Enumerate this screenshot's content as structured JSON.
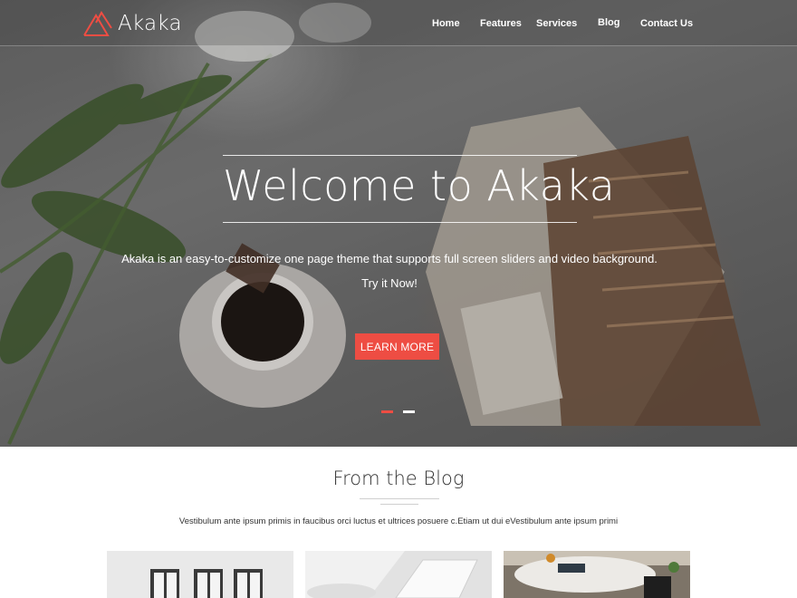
{
  "brand": {
    "name": "Akaka",
    "accent": "#ee4d43"
  },
  "nav": [
    {
      "label": "Home"
    },
    {
      "label": "Features"
    },
    {
      "label": "Services"
    },
    {
      "label": "Blog"
    },
    {
      "label": "Contact Us"
    }
  ],
  "hero": {
    "title": "Welcome to Akaka",
    "subtitle": "Akaka is an easy-to-customize one page theme that supports full screen sliders and video background.",
    "tagline": "Try it Now!",
    "cta_label": "LEARN MORE",
    "slider": {
      "slide_count": 2,
      "active_slide": 1,
      "active_color": "#ee4d43",
      "inactive_color": "#ffffff"
    }
  },
  "blog": {
    "title": "From the Blog",
    "description": "Vestibulum ante ipsum primis in faucibus orci luctus et ultrices posuere c.Etiam ut dui eVestibulum ante ipsum primi",
    "posts": [
      {
        "image": "white-room-windows-image"
      },
      {
        "image": "laptop-hands-image"
      },
      {
        "image": "cafe-table-image"
      }
    ]
  }
}
